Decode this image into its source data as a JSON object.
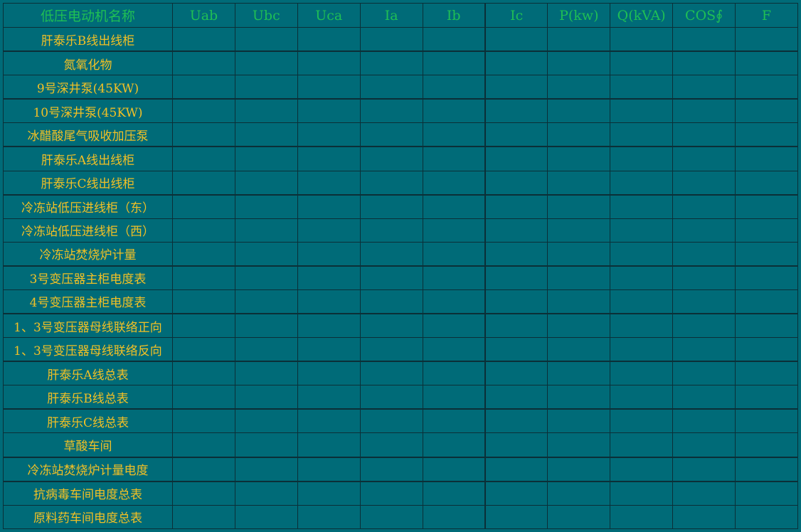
{
  "table": {
    "headers": [
      "低压电动机名称",
      "Uab",
      "Ubc",
      "Uca",
      "Ia",
      "Ib",
      "Ic",
      "P(kw)",
      "Q(kVA)",
      "COS∮",
      "F"
    ],
    "rows": [
      {
        "name": "肝泰乐B线出线柜",
        "values": [
          "",
          "",
          "",
          "",
          "",
          "",
          "",
          "",
          "",
          ""
        ]
      },
      {
        "name": "氮氧化物",
        "values": [
          "",
          "",
          "",
          "",
          "",
          "",
          "",
          "",
          "",
          ""
        ]
      },
      {
        "name": "9号深井泵(45KW)",
        "values": [
          "",
          "",
          "",
          "",
          "",
          "",
          "",
          "",
          "",
          ""
        ]
      },
      {
        "name": "10号深井泵(45KW)",
        "values": [
          "",
          "",
          "",
          "",
          "",
          "",
          "",
          "",
          "",
          ""
        ]
      },
      {
        "name": "冰醋酸尾气吸收加压泵",
        "values": [
          "",
          "",
          "",
          "",
          "",
          "",
          "",
          "",
          "",
          ""
        ]
      },
      {
        "name": "肝泰乐A线出线柜",
        "values": [
          "",
          "",
          "",
          "",
          "",
          "",
          "",
          "",
          "",
          ""
        ]
      },
      {
        "name": "肝泰乐C线出线柜",
        "values": [
          "",
          "",
          "",
          "",
          "",
          "",
          "",
          "",
          "",
          ""
        ]
      },
      {
        "name": "冷冻站低压进线柜（东）",
        "values": [
          "",
          "",
          "",
          "",
          "",
          "",
          "",
          "",
          "",
          ""
        ]
      },
      {
        "name": "冷冻站低压进线柜（西）",
        "values": [
          "",
          "",
          "",
          "",
          "",
          "",
          "",
          "",
          "",
          ""
        ]
      },
      {
        "name": "冷冻站焚烧炉计量",
        "values": [
          "",
          "",
          "",
          "",
          "",
          "",
          "",
          "",
          "",
          ""
        ]
      },
      {
        "name": "3号变压器主柜电度表",
        "values": [
          "",
          "",
          "",
          "",
          "",
          "",
          "",
          "",
          "",
          ""
        ]
      },
      {
        "name": "4号变压器主柜电度表",
        "values": [
          "",
          "",
          "",
          "",
          "",
          "",
          "",
          "",
          "",
          ""
        ]
      },
      {
        "name": "1、3号变压器母线联络正向",
        "values": [
          "",
          "",
          "",
          "",
          "",
          "",
          "",
          "",
          "",
          ""
        ]
      },
      {
        "name": "1、3号变压器母线联络反向",
        "values": [
          "",
          "",
          "",
          "",
          "",
          "",
          "",
          "",
          "",
          ""
        ]
      },
      {
        "name": "肝泰乐A线总表",
        "values": [
          "",
          "",
          "",
          "",
          "",
          "",
          "",
          "",
          "",
          ""
        ]
      },
      {
        "name": "肝泰乐B线总表",
        "values": [
          "",
          "",
          "",
          "",
          "",
          "",
          "",
          "",
          "",
          ""
        ]
      },
      {
        "name": "肝泰乐C线总表",
        "values": [
          "",
          "",
          "",
          "",
          "",
          "",
          "",
          "",
          "",
          ""
        ]
      },
      {
        "name": "草酸车间",
        "values": [
          "",
          "",
          "",
          "",
          "",
          "",
          "",
          "",
          "",
          ""
        ]
      },
      {
        "name": "冷冻站焚烧炉计量电度",
        "values": [
          "",
          "",
          "",
          "",
          "",
          "",
          "",
          "",
          "",
          ""
        ]
      },
      {
        "name": "抗病毒车间电度总表",
        "values": [
          "",
          "",
          "",
          "",
          "",
          "",
          "",
          "",
          "",
          ""
        ]
      },
      {
        "name": "原料药车间电度总表",
        "values": [
          "",
          "",
          "",
          "",
          "",
          "",
          "",
          "",
          "",
          ""
        ]
      }
    ]
  },
  "colors": {
    "background": "#006b78",
    "grid_line": "#0b2f37",
    "header_text": "#1fbf55",
    "name_text": "#f2c025"
  }
}
